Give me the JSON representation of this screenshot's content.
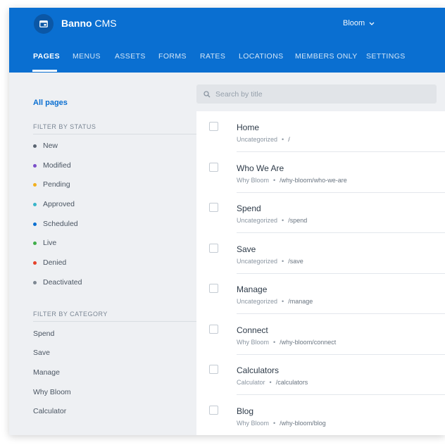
{
  "app": {
    "brand": "Banno",
    "product": "CMS",
    "bank": "Bloom"
  },
  "nav": {
    "tabs": [
      "PAGES",
      "MENUS",
      "ASSETS",
      "FORMS",
      "RATES",
      "LOCATIONS",
      "MEMBERS ONLY",
      "SETTINGS"
    ],
    "active": "PAGES"
  },
  "sidebar": {
    "all_pages": "All pages",
    "status_heading": "FILTER BY STATUS",
    "statuses": [
      {
        "label": "New",
        "color": "#5a6470"
      },
      {
        "label": "Modified",
        "color": "#7b4fc9"
      },
      {
        "label": "Pending",
        "color": "#f2b01e"
      },
      {
        "label": "Approved",
        "color": "#3ab5c9"
      },
      {
        "label": "Scheduled",
        "color": "#0a6fd1"
      },
      {
        "label": "Live",
        "color": "#3fae49"
      },
      {
        "label": "Denied",
        "color": "#e5422b"
      },
      {
        "label": "Deactivated",
        "color": "#7d8792"
      }
    ],
    "category_heading": "FILTER BY CATEGORY",
    "categories": [
      "Spend",
      "Save",
      "Manage",
      "Why Bloom",
      "Calculator"
    ]
  },
  "search": {
    "placeholder": "Search by title",
    "value": ""
  },
  "pages": [
    {
      "title": "Home",
      "category": "Uncategorized",
      "path": "/"
    },
    {
      "title": "Who We Are",
      "category": "Why Bloom",
      "path": "/why-bloom/who-we-are"
    },
    {
      "title": "Spend",
      "category": "Uncategorized",
      "path": "/spend"
    },
    {
      "title": "Save",
      "category": "Uncategorized",
      "path": "/save"
    },
    {
      "title": "Manage",
      "category": "Uncategorized",
      "path": "/manage"
    },
    {
      "title": "Connect",
      "category": "Why Bloom",
      "path": "/why-bloom/connect"
    },
    {
      "title": "Calculators",
      "category": "Calculator",
      "path": "/calculators"
    },
    {
      "title": "Blog",
      "category": "Why Bloom",
      "path": "/why-bloom/blog"
    }
  ],
  "colors": {
    "accent": "#0a6fd1",
    "header": "#0a6fd1",
    "sidebar_bg": "#eef0f3"
  },
  "icons": {
    "app": "browser-window-icon",
    "bank_select": "chevron-down-icon",
    "search": "search-icon"
  }
}
